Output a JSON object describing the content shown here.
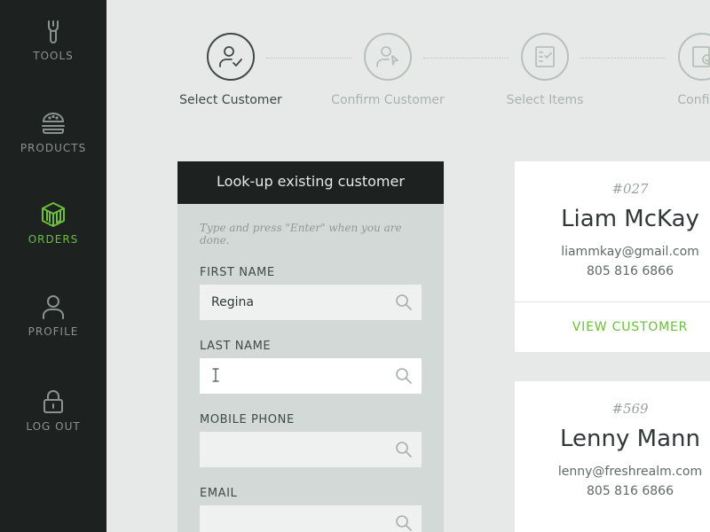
{
  "sidebar": {
    "items": [
      {
        "label": "TOOLS",
        "icon": "wrench-icon"
      },
      {
        "label": "PRODUCTS",
        "icon": "burger-icon"
      },
      {
        "label": "ORDERS",
        "icon": "box-icon"
      },
      {
        "label": "PROFILE",
        "icon": "user-icon"
      },
      {
        "label": "LOG OUT",
        "icon": "lock-icon"
      }
    ],
    "active": "ORDERS"
  },
  "colors": {
    "accent": "#6bbf3a",
    "sidebar_bg": "#1d2221",
    "page_bg": "#e6e9e7"
  },
  "steps": [
    {
      "label": "Select Customer",
      "icon": "user-check-icon"
    },
    {
      "label": "Confirm Customer",
      "icon": "user-arrow-icon"
    },
    {
      "label": "Select Items",
      "icon": "checklist-icon"
    },
    {
      "label": "Confirm",
      "icon": "confirm-order-icon"
    }
  ],
  "lookup": {
    "title": "Look-up existing customer",
    "hint": "Type and press \"Enter\" when you are done.",
    "fields": [
      {
        "label": "FIRST NAME",
        "value": "Regina",
        "placeholder": ""
      },
      {
        "label": "LAST NAME",
        "value": "",
        "placeholder": ""
      },
      {
        "label": "MOBILE PHONE",
        "value": "",
        "placeholder": ""
      },
      {
        "label": "EMAIL",
        "value": "",
        "placeholder": ""
      }
    ]
  },
  "customers": [
    {
      "number": "#027",
      "name": "Liam McKay",
      "email": "liammkay@gmail.com",
      "phone": "805 816 6866",
      "action": "VIEW CUSTOMER"
    },
    {
      "number": "#569",
      "name": "Lenny Mann",
      "email": "lenny@freshrealm.com",
      "phone": "805 816 6866"
    }
  ]
}
